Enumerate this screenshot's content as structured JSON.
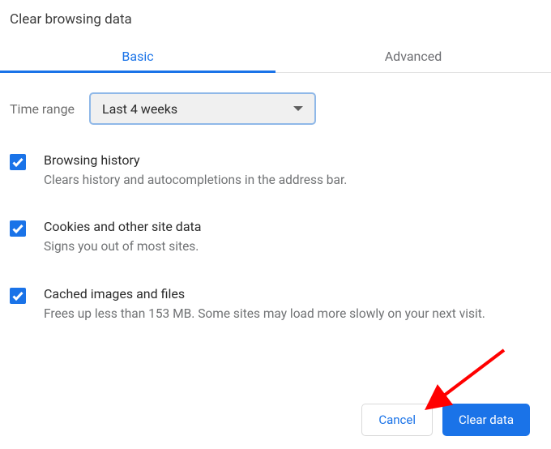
{
  "dialog": {
    "title": "Clear browsing data",
    "tabs": {
      "basic": "Basic",
      "advanced": "Advanced"
    },
    "time_range": {
      "label": "Time range",
      "value": "Last 4 weeks"
    },
    "options": [
      {
        "title": "Browsing history",
        "desc": "Clears history and autocompletions in the address bar.",
        "checked": true
      },
      {
        "title": "Cookies and other site data",
        "desc": "Signs you out of most sites.",
        "checked": true
      },
      {
        "title": "Cached images and files",
        "desc": "Frees up less than 153 MB. Some sites may load more slowly on your next visit.",
        "checked": true
      }
    ],
    "buttons": {
      "cancel": "Cancel",
      "clear": "Clear data"
    }
  },
  "annotation": {
    "arrow_color": "#ff0000"
  }
}
